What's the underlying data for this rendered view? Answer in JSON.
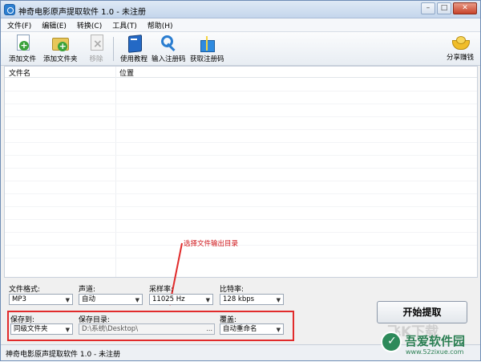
{
  "window": {
    "title": "神奇电影原声提取软件 1.0 - 未注册"
  },
  "window_controls": {
    "minimize": "–",
    "maximize": "□",
    "close": "✕"
  },
  "menu": [
    "文件(F)",
    "编辑(E)",
    "转换(C)",
    "工具(T)",
    "帮助(H)"
  ],
  "toolbar": {
    "add_file": "添加文件",
    "add_folder": "添加文件夹",
    "remove": "移除",
    "tutorial": "使用教程",
    "enter_code": "输入注册码",
    "get_code": "获取注册码",
    "share": "分享赚钱"
  },
  "list": {
    "col_filename": "文件名",
    "col_location": "位置"
  },
  "settings": {
    "format_label": "文件格式:",
    "format_value": "MP3",
    "channel_label": "声道:",
    "channel_value": "自动",
    "samplerate_label": "采样率:",
    "samplerate_value": "11025 Hz",
    "bitrate_label": "比特率:",
    "bitrate_value": "128 kbps",
    "saveto_label": "保存到:",
    "saveto_value": "同级文件夹",
    "savedir_label": "保存目录:",
    "savedir_value": "D:\\系统\\Desktop\\",
    "browse": "...",
    "overwrite_label": "覆盖:",
    "overwrite_value": "自动重命名"
  },
  "annotation": "选择文件输出目录",
  "start_button": "开始提取",
  "status": "神奇电影原声提取软件 1.0 - 未注册",
  "watermark": {
    "text": "飞K下载",
    "name": "吾爱软件园",
    "url": "www.52zixue.com"
  },
  "colors": {
    "highlight": "#e12b2b",
    "annotation": "#d0161a",
    "watermark_green": "#2b7f53"
  }
}
